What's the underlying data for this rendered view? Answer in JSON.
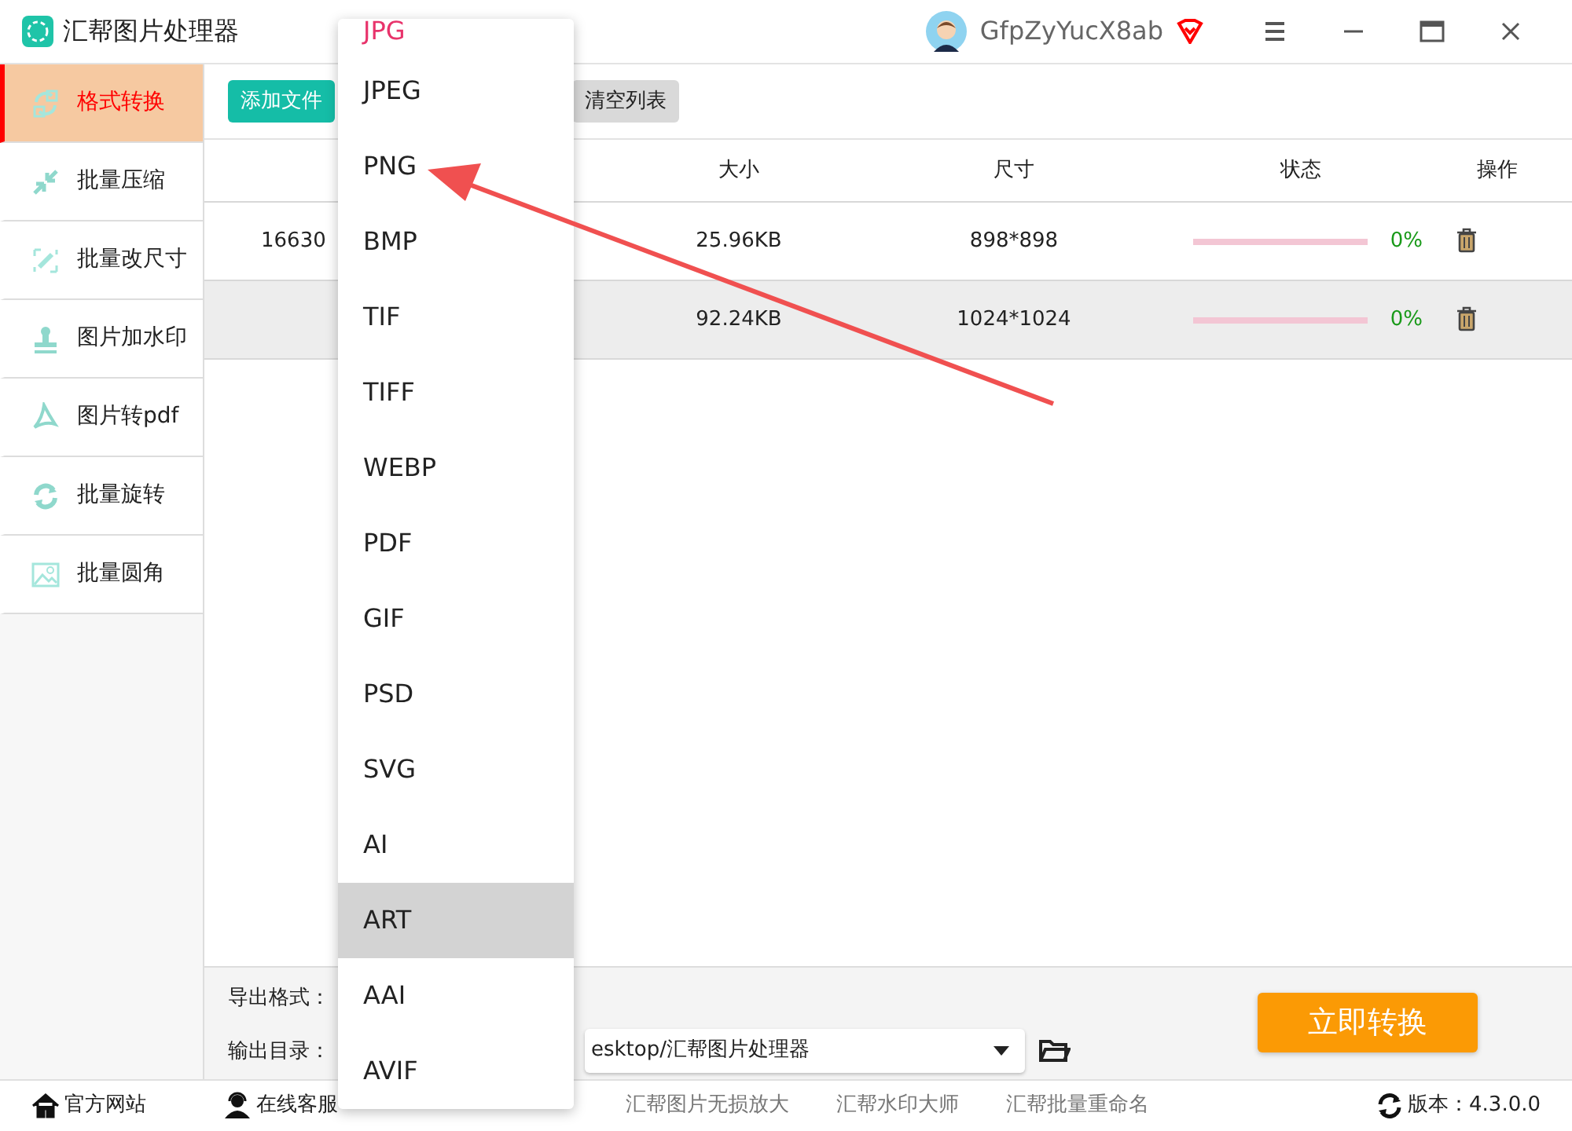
{
  "app": {
    "title": "汇帮图片处理器",
    "user": "GfpZyYucX8ab"
  },
  "sidebar": [
    {
      "label": "格式转换",
      "kind": "swap",
      "selected": true
    },
    {
      "label": "批量压缩",
      "kind": "compress",
      "selected": false
    },
    {
      "label": "批量改尺寸",
      "kind": "resize",
      "selected": false
    },
    {
      "label": "图片加水印",
      "kind": "stamp",
      "selected": false
    },
    {
      "label": "图片转pdf",
      "kind": "pdf",
      "selected": false
    },
    {
      "label": "批量旋转",
      "kind": "rotate",
      "selected": false
    },
    {
      "label": "批量圆角",
      "kind": "image",
      "selected": false
    }
  ],
  "toolbar": {
    "add_button": "添加文件",
    "clear_button": "清空列表"
  },
  "table": {
    "columns": [
      "大小",
      "尺寸",
      "状态",
      "操作"
    ],
    "rows": [
      {
        "name": "16630",
        "size": "25.96KB",
        "dimensions": "898*898",
        "level": 0,
        "percent": "0%",
        "selected": false
      },
      {
        "size": "92.24KB",
        "dimensions": "1024*1024",
        "level": 0,
        "percent": "0%",
        "selected": true
      }
    ]
  },
  "bottom": {
    "format_label": "导出格式：",
    "output_label": "输出目录：",
    "output_value": "esktop/汇帮图片处理器",
    "convert_button": "立即转换"
  },
  "format_menu": [
    {
      "label": "JPG",
      "selected": true,
      "highlighted": false
    },
    {
      "label": "JPEG",
      "selected": false,
      "highlighted": false
    },
    {
      "label": "PNG",
      "selected": false,
      "highlighted": false
    },
    {
      "label": "BMP",
      "selected": false,
      "highlighted": false
    },
    {
      "label": "TIF",
      "selected": false,
      "highlighted": false
    },
    {
      "label": "TIFF",
      "selected": false,
      "highlighted": false
    },
    {
      "label": "WEBP",
      "selected": false,
      "highlighted": false
    },
    {
      "label": "PDF",
      "selected": false,
      "highlighted": false
    },
    {
      "label": "GIF",
      "selected": false,
      "highlighted": false
    },
    {
      "label": "PSD",
      "selected": false,
      "highlighted": false
    },
    {
      "label": "SVG",
      "selected": false,
      "highlighted": false
    },
    {
      "label": "AI",
      "selected": false,
      "highlighted": false
    },
    {
      "label": "ART",
      "selected": false,
      "highlighted": true
    },
    {
      "label": "AAI",
      "selected": false,
      "highlighted": false
    },
    {
      "label": "AVIF",
      "selected": false,
      "highlighted": false
    }
  ],
  "footer": {
    "links": [
      {
        "label": "官方网站",
        "kind": "home"
      },
      {
        "label": "在线客服",
        "kind": "support"
      },
      {
        "label": "汇帮图片无损放大",
        "kind": "plain"
      },
      {
        "label": "汇帮水印大师",
        "kind": "plain"
      },
      {
        "label": "汇帮批量重命名",
        "kind": "plain"
      }
    ],
    "version": "版本：4.3.0.0"
  }
}
